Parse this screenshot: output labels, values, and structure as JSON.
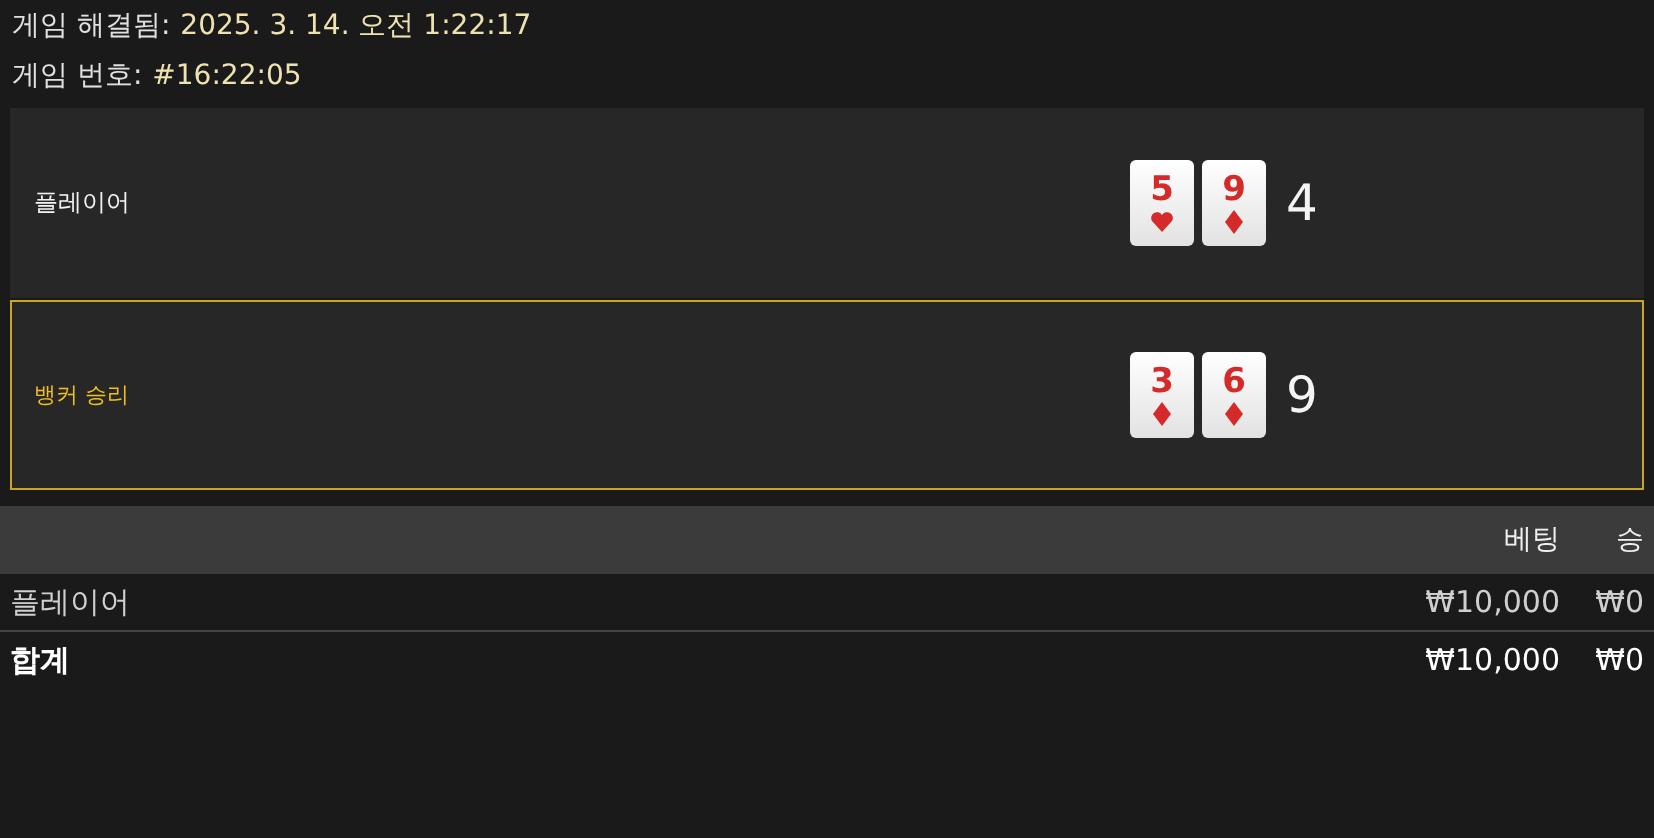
{
  "info": [
    {
      "label": "게임 해결됨:",
      "value": "2025. 3. 14. 오전 1:22:17"
    },
    {
      "label": "게임 번호:",
      "value": "#16:22:05"
    }
  ],
  "hands": [
    {
      "label": "플레이어",
      "winner": false,
      "cards": [
        {
          "rank": "5",
          "kind": "hearts"
        },
        {
          "rank": "9",
          "kind": "diamonds"
        }
      ],
      "score": "4"
    },
    {
      "label": "뱅커 승리",
      "winner": true,
      "cards": [
        {
          "rank": "3",
          "kind": "diamonds"
        },
        {
          "rank": "6",
          "kind": "diamonds"
        }
      ],
      "score": "9"
    }
  ],
  "table": {
    "columns": [
      "베팅",
      "승"
    ],
    "rows": [
      {
        "kind": "bet",
        "label": "플레이어",
        "bet": "₩10,000",
        "win": "₩0"
      },
      {
        "kind": "total",
        "label": "합계",
        "bet": "₩10,000",
        "win": "₩0"
      }
    ]
  }
}
